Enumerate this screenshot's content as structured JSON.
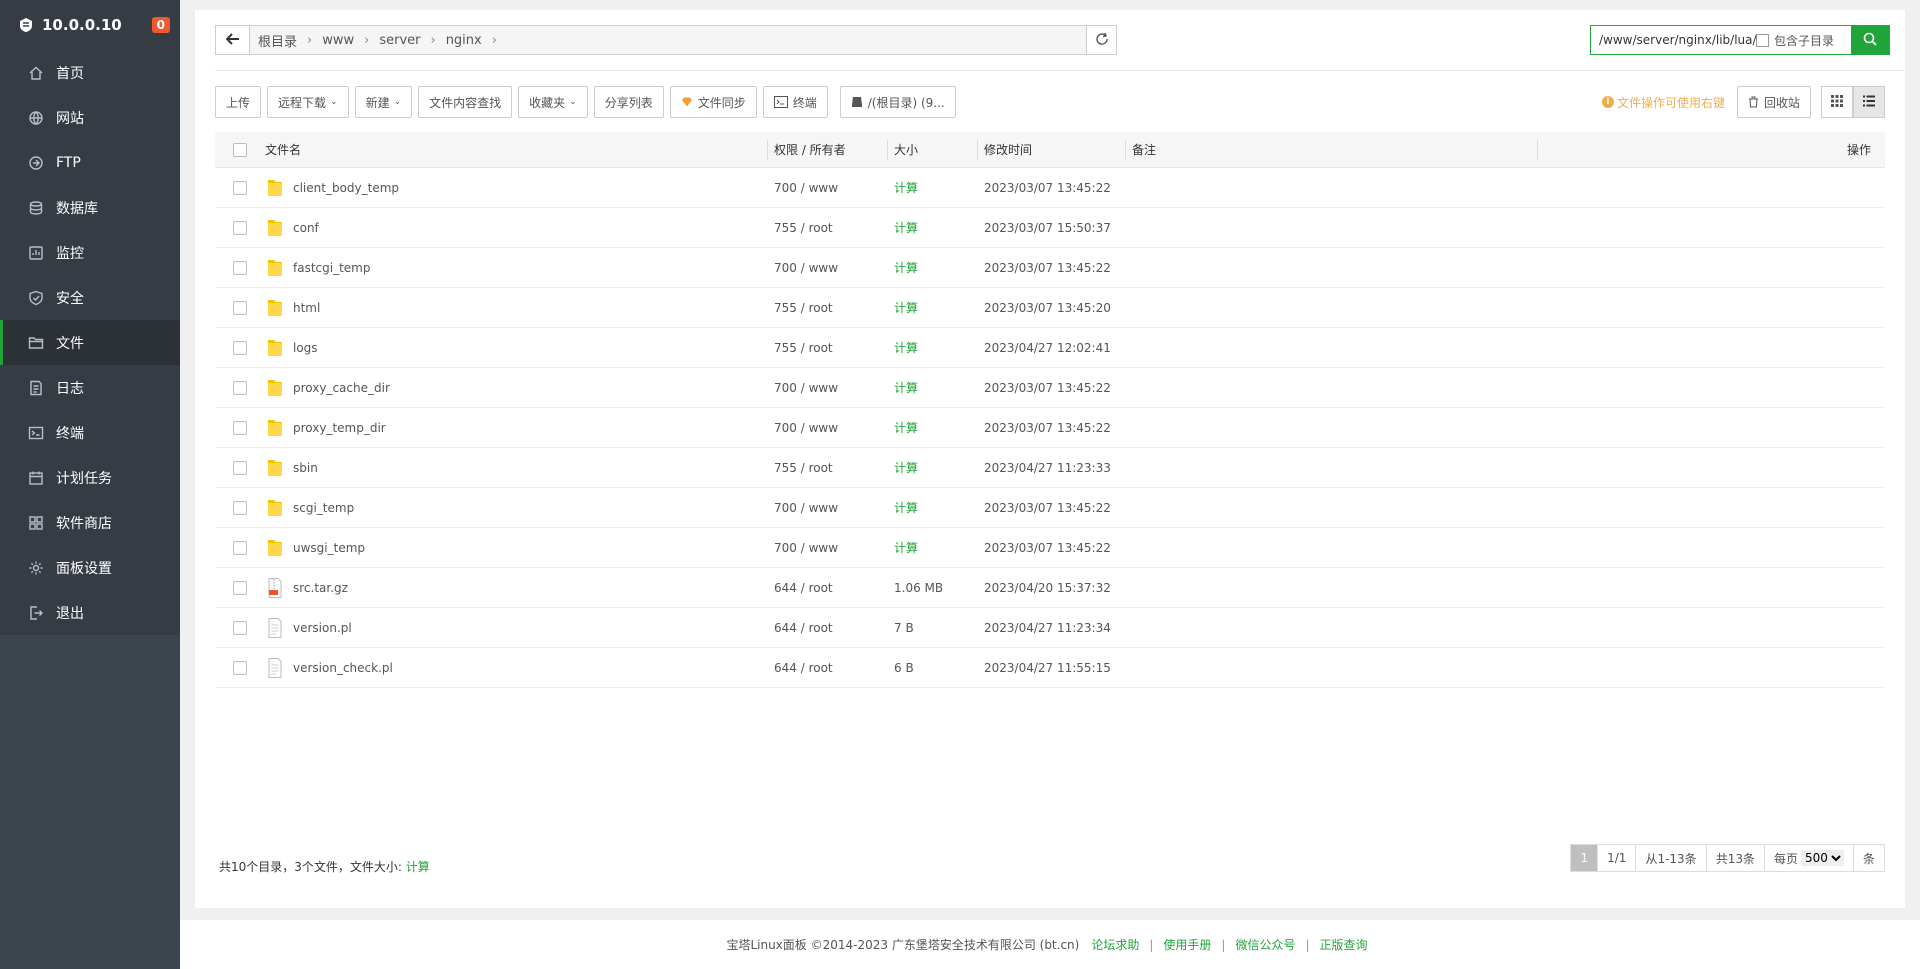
{
  "sidebar": {
    "host": "10.0.0.10",
    "badge": "0",
    "items": [
      {
        "label": "首页",
        "icon": "home-icon"
      },
      {
        "label": "网站",
        "icon": "globe-icon"
      },
      {
        "label": "FTP",
        "icon": "ftp-icon"
      },
      {
        "label": "数据库",
        "icon": "database-icon"
      },
      {
        "label": "监控",
        "icon": "monitor-icon"
      },
      {
        "label": "安全",
        "icon": "shield-icon"
      },
      {
        "label": "文件",
        "icon": "folder-icon"
      },
      {
        "label": "日志",
        "icon": "log-icon"
      },
      {
        "label": "终端",
        "icon": "terminal-icon"
      },
      {
        "label": "计划任务",
        "icon": "calendar-icon"
      },
      {
        "label": "软件商店",
        "icon": "apps-icon"
      },
      {
        "label": "面板设置",
        "icon": "settings-icon"
      },
      {
        "label": "退出",
        "icon": "logout-icon"
      }
    ],
    "active_index": 6
  },
  "pathbar": {
    "crumbs": [
      "根目录",
      "www",
      "server",
      "nginx"
    ]
  },
  "search": {
    "value": "/www/server/nginx/lib/lua/",
    "subdir_label": "包含子目录"
  },
  "toolbar": {
    "upload": "上传",
    "remote_download": "远程下载",
    "new": "新建",
    "content_search": "文件内容查找",
    "favorites": "收藏夹",
    "share_list": "分享列表",
    "file_sync": "文件同步",
    "terminal": "终端",
    "disk": "/(根目录) (9...",
    "tip": "文件操作可使用右键",
    "recycle": "回收站"
  },
  "table": {
    "headers": {
      "name": "文件名",
      "perm": "权限 / 所有者",
      "size": "大小",
      "mtime": "修改时间",
      "note": "备注",
      "op": "操作"
    },
    "rows": [
      {
        "type": "folder",
        "name": "client_body_temp",
        "perm": "700 / www",
        "size": "计算",
        "mtime": "2023/03/07 13:45:22"
      },
      {
        "type": "folder",
        "name": "conf",
        "perm": "755 / root",
        "size": "计算",
        "mtime": "2023/03/07 15:50:37"
      },
      {
        "type": "folder",
        "name": "fastcgi_temp",
        "perm": "700 / www",
        "size": "计算",
        "mtime": "2023/03/07 13:45:22"
      },
      {
        "type": "folder",
        "name": "html",
        "perm": "755 / root",
        "size": "计算",
        "mtime": "2023/03/07 13:45:20"
      },
      {
        "type": "folder",
        "name": "logs",
        "perm": "755 / root",
        "size": "计算",
        "mtime": "2023/04/27 12:02:41"
      },
      {
        "type": "folder",
        "name": "proxy_cache_dir",
        "perm": "700 / www",
        "size": "计算",
        "mtime": "2023/03/07 13:45:22"
      },
      {
        "type": "folder",
        "name": "proxy_temp_dir",
        "perm": "700 / www",
        "size": "计算",
        "mtime": "2023/03/07 13:45:22"
      },
      {
        "type": "folder",
        "name": "sbin",
        "perm": "755 / root",
        "size": "计算",
        "mtime": "2023/04/27 11:23:33"
      },
      {
        "type": "folder",
        "name": "scgi_temp",
        "perm": "700 / www",
        "size": "计算",
        "mtime": "2023/03/07 13:45:22"
      },
      {
        "type": "folder",
        "name": "uwsgi_temp",
        "perm": "700 / www",
        "size": "计算",
        "mtime": "2023/03/07 13:45:22"
      },
      {
        "type": "archive",
        "name": "src.tar.gz",
        "perm": "644 / root",
        "size": "1.06 MB",
        "mtime": "2023/04/20 15:37:32"
      },
      {
        "type": "file",
        "name": "version.pl",
        "perm": "644 / root",
        "size": "7 B",
        "mtime": "2023/04/27 11:23:34"
      },
      {
        "type": "file",
        "name": "version_check.pl",
        "perm": "644 / root",
        "size": "6 B",
        "mtime": "2023/04/27 11:55:15"
      }
    ]
  },
  "summary": {
    "text": "共10个目录，3个文件，文件大小:",
    "calc": "计算"
  },
  "pager": {
    "current": "1",
    "pages": "1/1",
    "range": "从1-13条",
    "total": "共13条",
    "per_page_label": "每页",
    "per_page_value": "500",
    "unit": "条"
  },
  "footer": {
    "copyright": "宝塔Linux面板 ©2014-2023 广东堡塔安全技术有限公司 (bt.cn)",
    "links": [
      "论坛求助",
      "使用手册",
      "微信公众号",
      "正版查询"
    ]
  },
  "colors": {
    "accent": "#20a53a",
    "sidebar": "#3c444d",
    "badge": "#f0592b",
    "tip": "#f0ad4e"
  }
}
